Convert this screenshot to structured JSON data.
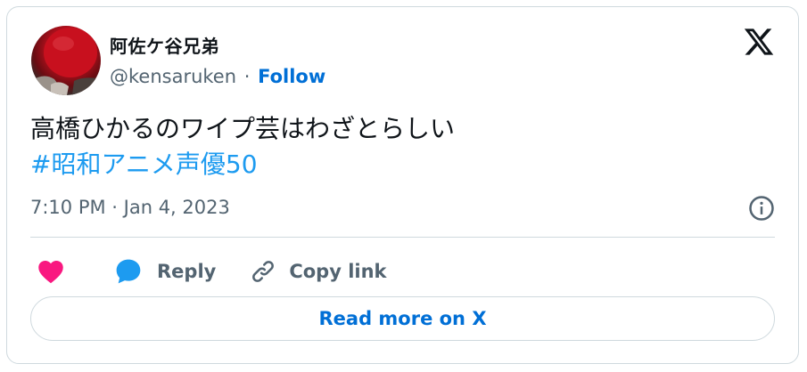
{
  "author": {
    "display_name": "阿佐ケ谷兄弟",
    "handle": "@kensaruken",
    "separator": "·",
    "follow_label": "Follow"
  },
  "tweet": {
    "text": "高橋ひかるのワイプ芸はわざとらしい",
    "hashtag": "#昭和アニメ声優50",
    "timestamp": "7:10 PM · Jan 4, 2023"
  },
  "actions": {
    "reply_label": "Reply",
    "copy_link_label": "Copy link",
    "read_more_label": "Read more on X"
  },
  "icons": {
    "avatar": "profile-photo",
    "x_logo": "x-logo-icon",
    "info": "info-icon",
    "like": "heart-icon",
    "reply": "speech-bubble-icon",
    "copy_link": "link-icon"
  },
  "colors": {
    "link_blue": "#006fd6",
    "hashtag_blue": "#1d9bf0",
    "like_pink": "#f91880",
    "reply_blue": "#1d9bf0",
    "muted_text": "#536471",
    "border": "#cfd9de"
  }
}
